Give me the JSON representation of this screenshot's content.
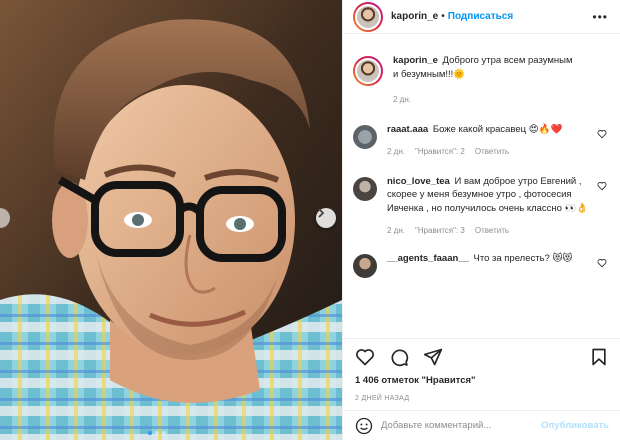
{
  "post": {
    "username": "kaporin_e",
    "separator": "•",
    "follow_label": "Подписаться",
    "more_label": "•••",
    "caption_text": "Доброго утра всем разумным и безумным!!!🌞",
    "caption_time": "2 дн."
  },
  "comments": [
    {
      "username": "raaat.aaa",
      "text": "Боже какой красавец 😍🔥❤️",
      "time": "2 дн.",
      "likes": "\"Нравится\": 2",
      "reply": "Ответить"
    },
    {
      "username": "nico_love_tea",
      "text": "И вам доброе утро Евгений , скорее у меня безумное утро , фотосесия Ивченка , но получилось очень классно 👀👌",
      "time": "2 дн.",
      "likes": "\"Нравится\": 3",
      "reply": "Ответить"
    },
    {
      "username": "__agents_faaan__",
      "text": "Что за прелесть? 😻😻",
      "time": "",
      "likes": "",
      "reply": ""
    }
  ],
  "stats": {
    "likes_text": "1 406 отметок \"Нравится\"",
    "date_text": "2 ДНЕЙ НАЗАД"
  },
  "add_comment": {
    "placeholder": "Добавьте комментарий...",
    "publish_label": "Опубликовать"
  },
  "colors": {
    "accent": "#0095f6",
    "muted": "#8e8e8e",
    "publish_disabled": "#b2dffc"
  }
}
